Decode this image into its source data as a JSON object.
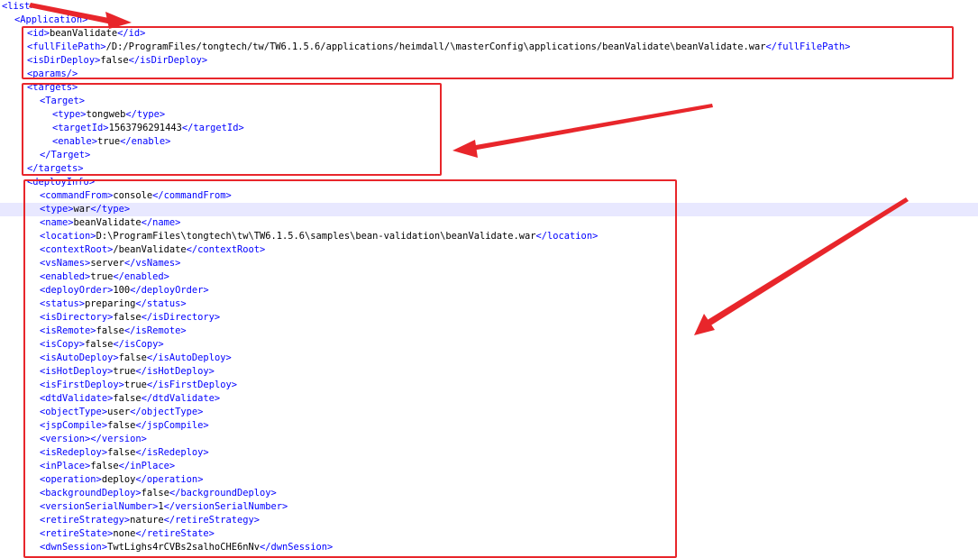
{
  "colors": {
    "tag": "#0000ff",
    "text": "#000000",
    "highlight": "#e8e8ff",
    "annotation": "#e8262b"
  },
  "lines": [
    {
      "indent": 0,
      "parts": [
        {
          "t": "<list>",
          "tag": true
        }
      ]
    },
    {
      "indent": 1,
      "parts": [
        {
          "t": "<Application>",
          "tag": true
        }
      ]
    },
    {
      "indent": 2,
      "parts": [
        {
          "t": "<id>",
          "tag": true
        },
        {
          "t": "beanValidate"
        },
        {
          "t": "</id>",
          "tag": true
        }
      ]
    },
    {
      "indent": 2,
      "parts": [
        {
          "t": "<fullFilePath>",
          "tag": true
        },
        {
          "t": "/D:/ProgramFiles/tongtech/tw/TW6.1.5.6/applications/heimdall/\\masterConfig\\applications/beanValidate\\beanValidate.war"
        },
        {
          "t": "</fullFilePath>",
          "tag": true
        }
      ]
    },
    {
      "indent": 2,
      "parts": [
        {
          "t": "<isDirDeploy>",
          "tag": true
        },
        {
          "t": "false"
        },
        {
          "t": "</isDirDeploy>",
          "tag": true
        }
      ]
    },
    {
      "indent": 2,
      "parts": [
        {
          "t": "<params/>",
          "tag": true
        }
      ]
    },
    {
      "indent": 2,
      "parts": [
        {
          "t": "<targets>",
          "tag": true
        }
      ]
    },
    {
      "indent": 3,
      "parts": [
        {
          "t": "<Target>",
          "tag": true
        }
      ]
    },
    {
      "indent": 4,
      "parts": [
        {
          "t": "<type>",
          "tag": true
        },
        {
          "t": "tongweb"
        },
        {
          "t": "</type>",
          "tag": true
        }
      ]
    },
    {
      "indent": 4,
      "parts": [
        {
          "t": "<targetId>",
          "tag": true
        },
        {
          "t": "1563796291443"
        },
        {
          "t": "</targetId>",
          "tag": true
        }
      ]
    },
    {
      "indent": 4,
      "parts": [
        {
          "t": "<enable>",
          "tag": true
        },
        {
          "t": "true"
        },
        {
          "t": "</enable>",
          "tag": true
        }
      ]
    },
    {
      "indent": 3,
      "parts": [
        {
          "t": "</Target>",
          "tag": true
        }
      ]
    },
    {
      "indent": 2,
      "parts": [
        {
          "t": "</targets>",
          "tag": true
        }
      ]
    },
    {
      "indent": 2,
      "parts": [
        {
          "t": "<deployInfo>",
          "tag": true
        }
      ]
    },
    {
      "indent": 3,
      "parts": [
        {
          "t": "<commandFrom>",
          "tag": true
        },
        {
          "t": "console"
        },
        {
          "t": "</commandFrom>",
          "tag": true
        }
      ]
    },
    {
      "indent": 3,
      "highlight": true,
      "parts": [
        {
          "t": "<type>",
          "tag": true
        },
        {
          "t": "war"
        },
        {
          "t": "</type>",
          "tag": true
        }
      ]
    },
    {
      "indent": 3,
      "parts": [
        {
          "t": "<name>",
          "tag": true
        },
        {
          "t": "beanValidate"
        },
        {
          "t": "</name>",
          "tag": true
        }
      ]
    },
    {
      "indent": 3,
      "parts": [
        {
          "t": "<location>",
          "tag": true
        },
        {
          "t": "D:\\ProgramFiles\\tongtech\\tw\\TW6.1.5.6\\samples\\bean-validation\\beanValidate.war"
        },
        {
          "t": "</location>",
          "tag": true
        }
      ]
    },
    {
      "indent": 3,
      "parts": [
        {
          "t": "<contextRoot>",
          "tag": true
        },
        {
          "t": "/beanValidate"
        },
        {
          "t": "</contextRoot>",
          "tag": true
        }
      ]
    },
    {
      "indent": 3,
      "parts": [
        {
          "t": "<vsNames>",
          "tag": true
        },
        {
          "t": "server"
        },
        {
          "t": "</vsNames>",
          "tag": true
        }
      ]
    },
    {
      "indent": 3,
      "parts": [
        {
          "t": "<enabled>",
          "tag": true
        },
        {
          "t": "true"
        },
        {
          "t": "</enabled>",
          "tag": true
        }
      ]
    },
    {
      "indent": 3,
      "parts": [
        {
          "t": "<deployOrder>",
          "tag": true
        },
        {
          "t": "100"
        },
        {
          "t": "</deployOrder>",
          "tag": true
        }
      ]
    },
    {
      "indent": 3,
      "parts": [
        {
          "t": "<status>",
          "tag": true
        },
        {
          "t": "preparing"
        },
        {
          "t": "</status>",
          "tag": true
        }
      ]
    },
    {
      "indent": 3,
      "parts": [
        {
          "t": "<isDirectory>",
          "tag": true
        },
        {
          "t": "false"
        },
        {
          "t": "</isDirectory>",
          "tag": true
        }
      ]
    },
    {
      "indent": 3,
      "parts": [
        {
          "t": "<isRemote>",
          "tag": true
        },
        {
          "t": "false"
        },
        {
          "t": "</isRemote>",
          "tag": true
        }
      ]
    },
    {
      "indent": 3,
      "parts": [
        {
          "t": "<isCopy>",
          "tag": true
        },
        {
          "t": "false"
        },
        {
          "t": "</isCopy>",
          "tag": true
        }
      ]
    },
    {
      "indent": 3,
      "parts": [
        {
          "t": "<isAutoDeploy>",
          "tag": true
        },
        {
          "t": "false"
        },
        {
          "t": "</isAutoDeploy>",
          "tag": true
        }
      ]
    },
    {
      "indent": 3,
      "parts": [
        {
          "t": "<isHotDeploy>",
          "tag": true
        },
        {
          "t": "true"
        },
        {
          "t": "</isHotDeploy>",
          "tag": true
        }
      ]
    },
    {
      "indent": 3,
      "parts": [
        {
          "t": "<isFirstDeploy>",
          "tag": true
        },
        {
          "t": "true"
        },
        {
          "t": "</isFirstDeploy>",
          "tag": true
        }
      ]
    },
    {
      "indent": 3,
      "parts": [
        {
          "t": "<dtdValidate>",
          "tag": true
        },
        {
          "t": "false"
        },
        {
          "t": "</dtdValidate>",
          "tag": true
        }
      ]
    },
    {
      "indent": 3,
      "parts": [
        {
          "t": "<objectType>",
          "tag": true
        },
        {
          "t": "user"
        },
        {
          "t": "</objectType>",
          "tag": true
        }
      ]
    },
    {
      "indent": 3,
      "parts": [
        {
          "t": "<jspCompile>",
          "tag": true
        },
        {
          "t": "false"
        },
        {
          "t": "</jspCompile>",
          "tag": true
        }
      ]
    },
    {
      "indent": 3,
      "parts": [
        {
          "t": "<version>",
          "tag": true
        },
        {
          "t": "</version>",
          "tag": true
        }
      ]
    },
    {
      "indent": 3,
      "parts": [
        {
          "t": "<isRedeploy>",
          "tag": true
        },
        {
          "t": "false"
        },
        {
          "t": "</isRedeploy>",
          "tag": true
        }
      ]
    },
    {
      "indent": 3,
      "parts": [
        {
          "t": "<inPlace>",
          "tag": true
        },
        {
          "t": "false"
        },
        {
          "t": "</inPlace>",
          "tag": true
        }
      ]
    },
    {
      "indent": 3,
      "parts": [
        {
          "t": "<operation>",
          "tag": true
        },
        {
          "t": "deploy"
        },
        {
          "t": "</operation>",
          "tag": true
        }
      ]
    },
    {
      "indent": 3,
      "parts": [
        {
          "t": "<backgroundDeploy>",
          "tag": true
        },
        {
          "t": "false"
        },
        {
          "t": "</backgroundDeploy>",
          "tag": true
        }
      ]
    },
    {
      "indent": 3,
      "parts": [
        {
          "t": "<versionSerialNumber>",
          "tag": true
        },
        {
          "t": "1"
        },
        {
          "t": "</versionSerialNumber>",
          "tag": true
        }
      ]
    },
    {
      "indent": 3,
      "parts": [
        {
          "t": "<retireStrategy>",
          "tag": true
        },
        {
          "t": "nature"
        },
        {
          "t": "</retireStrategy>",
          "tag": true
        }
      ]
    },
    {
      "indent": 3,
      "parts": [
        {
          "t": "<retireState>",
          "tag": true
        },
        {
          "t": "none"
        },
        {
          "t": "</retireState>",
          "tag": true
        }
      ]
    },
    {
      "indent": 3,
      "parts": [
        {
          "t": "<dwnSession>",
          "tag": true
        },
        {
          "t": "TwtLighs4rCVBs2salhoCHE6nNv"
        },
        {
          "t": "</dwnSession>",
          "tag": true
        }
      ]
    }
  ]
}
